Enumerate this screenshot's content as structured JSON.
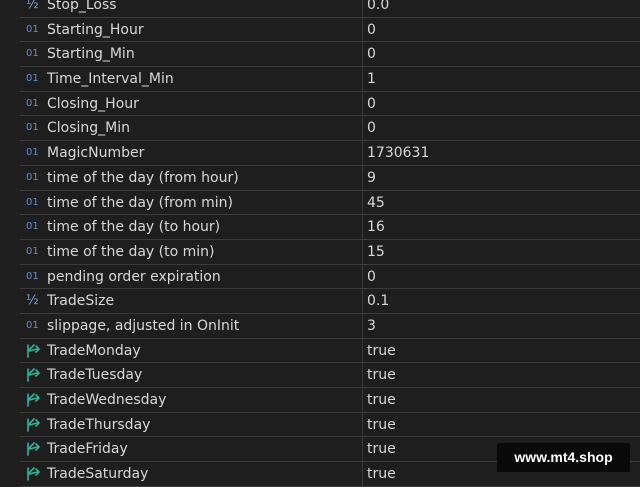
{
  "parameters": [
    {
      "type": "fraction",
      "icon": "½",
      "name": "Stop_Loss",
      "value": "0.0"
    },
    {
      "type": "int",
      "icon": "01",
      "name": "Starting_Hour",
      "value": "0"
    },
    {
      "type": "int",
      "icon": "01",
      "name": "Starting_Min",
      "value": "0"
    },
    {
      "type": "int",
      "icon": "01",
      "name": "Time_Interval_Min",
      "value": "1"
    },
    {
      "type": "int",
      "icon": "01",
      "name": "Closing_Hour",
      "value": "0"
    },
    {
      "type": "int",
      "icon": "01",
      "name": "Closing_Min",
      "value": "0"
    },
    {
      "type": "int",
      "icon": "01",
      "name": "MagicNumber",
      "value": "1730631"
    },
    {
      "type": "int",
      "icon": "01",
      "name": "time of the day (from hour)",
      "value": "9"
    },
    {
      "type": "int",
      "icon": "01",
      "name": "time of the day (from min)",
      "value": "45"
    },
    {
      "type": "int",
      "icon": "01",
      "name": "time of the day (to hour)",
      "value": "16"
    },
    {
      "type": "int",
      "icon": "01",
      "name": "time of the day (to min)",
      "value": "15"
    },
    {
      "type": "int",
      "icon": "01",
      "name": "pending order expiration",
      "value": "0"
    },
    {
      "type": "fraction",
      "icon": "½",
      "name": "TradeSize",
      "value": "0.1"
    },
    {
      "type": "int",
      "icon": "01",
      "name": "slippage, adjusted in OnInit",
      "value": "3"
    },
    {
      "type": "bool",
      "icon": "bool-arrow-icon",
      "name": "TradeMonday",
      "value": "true"
    },
    {
      "type": "bool",
      "icon": "bool-arrow-icon",
      "name": "TradeTuesday",
      "value": "true"
    },
    {
      "type": "bool",
      "icon": "bool-arrow-icon",
      "name": "TradeWednesday",
      "value": "true"
    },
    {
      "type": "bool",
      "icon": "bool-arrow-icon",
      "name": "TradeThursday",
      "value": "true"
    },
    {
      "type": "bool",
      "icon": "bool-arrow-icon",
      "name": "TradeFriday",
      "value": "true"
    },
    {
      "type": "bool",
      "icon": "bool-arrow-icon",
      "name": "TradeSaturday",
      "value": "true"
    }
  ],
  "watermark": {
    "text": "www.mt4.shop"
  },
  "colors": {
    "background": "#1e1e1e",
    "gridline": "#3a3a3a",
    "text": "#d8d8d8",
    "int_icon": "#5b8fd8",
    "bool_icon": "#2fb39a"
  }
}
